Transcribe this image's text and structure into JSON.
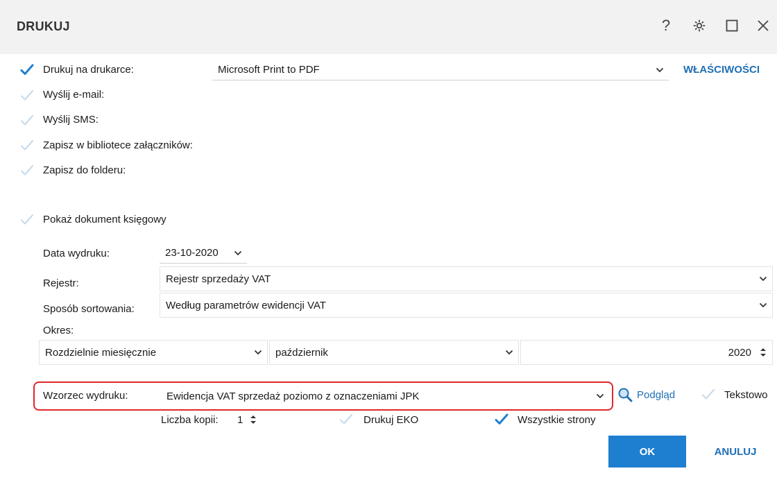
{
  "window": {
    "title": "DRUKUJ"
  },
  "titlebar_icons": [
    "help-icon",
    "gear-icon",
    "maximize-icon",
    "close-icon"
  ],
  "titlebar_glyphs": {
    "help": "?",
    "gear": "⚙",
    "maximize": "☐",
    "close": "✕"
  },
  "output": {
    "print": {
      "label": "Drukuj na drukarce:",
      "checked": true
    },
    "printer_value": "Microsoft Print to PDF",
    "properties_link": "WŁAŚCIWOŚCI",
    "email": {
      "label": "Wyślij e-mail:",
      "checked": false
    },
    "sms": {
      "label": "Wyślij SMS:",
      "checked": false
    },
    "library": {
      "label": "Zapisz w bibliotece załączników:",
      "checked": false
    },
    "folder": {
      "label": "Zapisz do folderu:",
      "checked": false
    }
  },
  "show_document": {
    "label": "Pokaż dokument księgowy",
    "checked": false
  },
  "fields": {
    "print_date_label": "Data wydruku:",
    "print_date_value": "23-10-2020",
    "register_label": "Rejestr:",
    "register_value": "Rejestr sprzedaży VAT",
    "sort_label": "Sposób sortowania:",
    "sort_value": "Według parametrów ewidencji VAT",
    "period_label": "Okres:",
    "period_mode_value": "Rozdzielnie miesięcznie",
    "period_month_value": "październik",
    "period_year_value": "2020",
    "template_label": "Wzorzec wydruku:",
    "template_value": "Ewidencja VAT sprzedaż poziomo z oznaczeniami JPK",
    "preview_link": "Podgląd",
    "text_mode": {
      "label": "Tekstowo",
      "checked": false
    },
    "copies_label": "Liczba kopii:",
    "copies_value": "1",
    "print_eko": {
      "label": "Drukuj EKO",
      "checked": false
    },
    "all_pages": {
      "label": "Wszystkie strony",
      "checked": true
    }
  },
  "buttons": {
    "ok": "OK",
    "cancel": "ANULUJ"
  },
  "colors": {
    "accent": "#1e7fd0",
    "link": "#1f6fb5",
    "highlight": "#e0262b",
    "check_on": "#1e7fd0",
    "check_off": "#c9dcec"
  }
}
